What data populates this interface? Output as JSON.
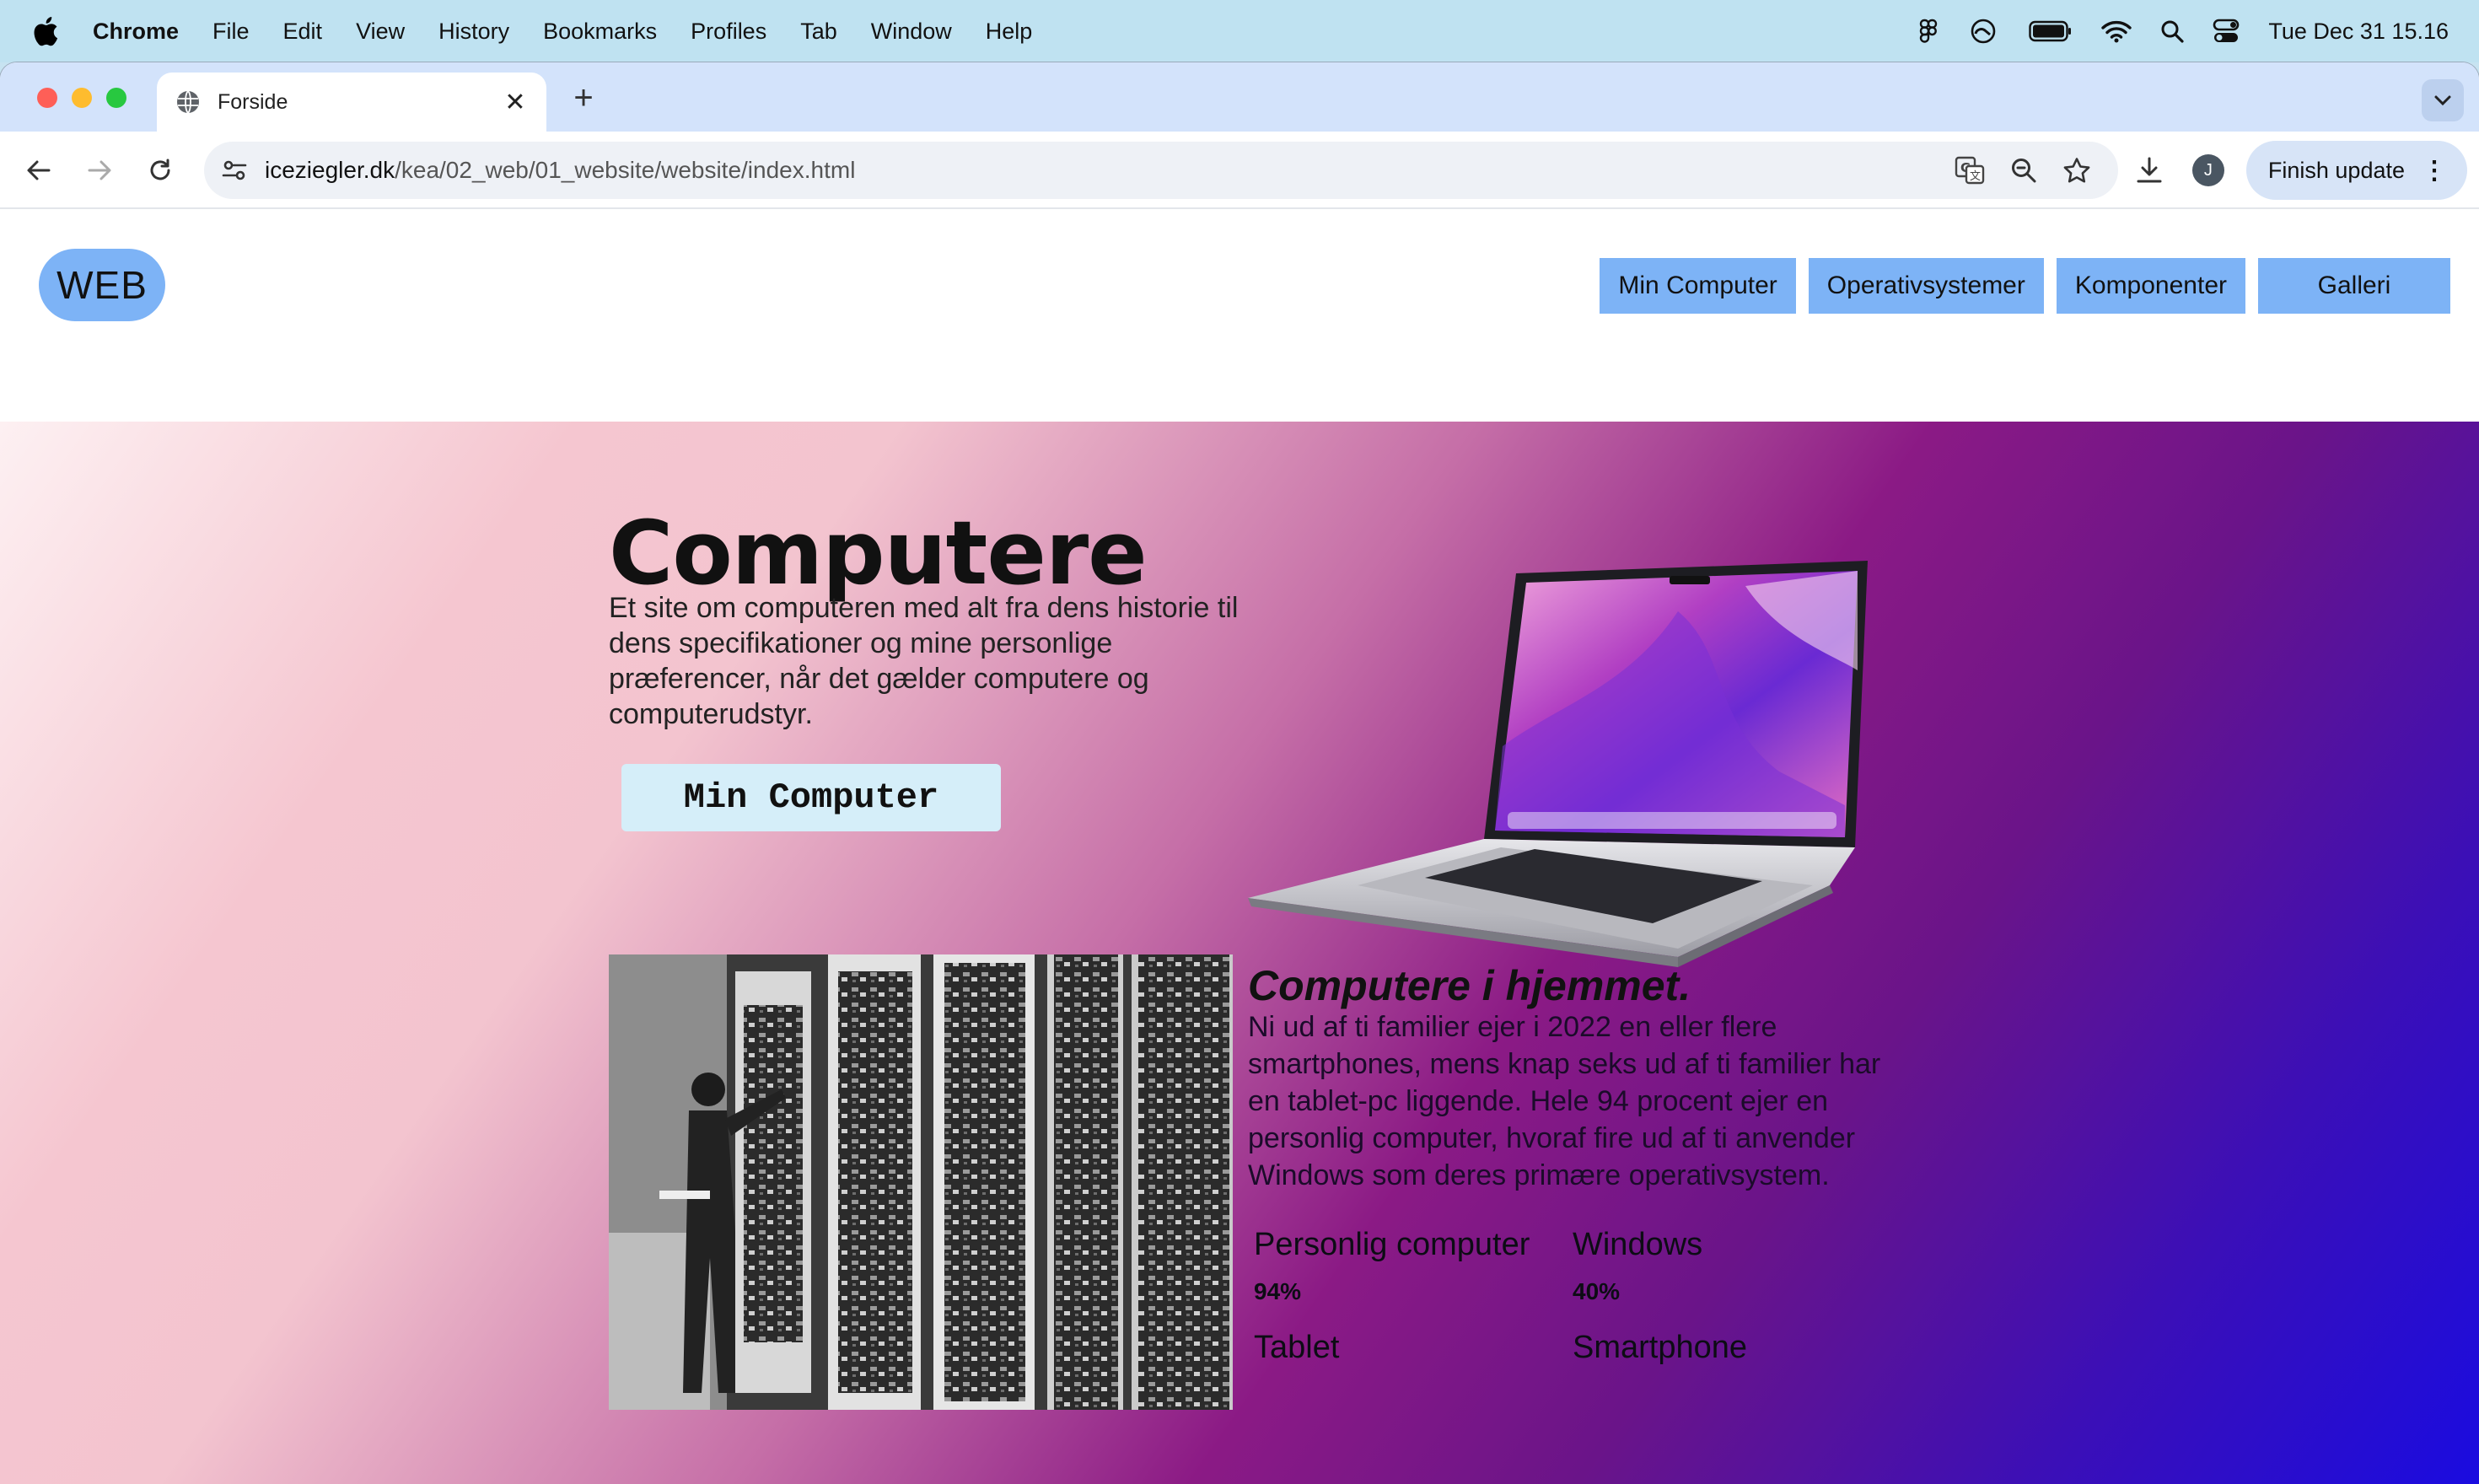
{
  "menubar": {
    "app_name": "Chrome",
    "items": [
      "File",
      "Edit",
      "View",
      "History",
      "Bookmarks",
      "Profiles",
      "Tab",
      "Window",
      "Help"
    ],
    "clock": "Tue Dec 31  15.16"
  },
  "browser": {
    "tab_title": "Forside",
    "url_host": "iceziegler.dk",
    "url_path": "/kea/02_web/01_website/website/index.html",
    "profile_initial": "J",
    "finish_update_label": "Finish update"
  },
  "site": {
    "logo": "WEB",
    "nav": [
      "Min Computer",
      "Operativsystemer",
      "Komponenter",
      "Galleri"
    ],
    "accent_color": "#7db3f6"
  },
  "hero": {
    "title": "Computere",
    "lead": "Et site om computeren med alt fra dens historie til dens specifikationer og mine personlige præferencer, når det gælder computere og computerudstyr.",
    "cta_label": "Min Computer"
  },
  "section": {
    "heading": "Computere i hjemmet.",
    "paragraph": "Ni ud af ti familier ejer i 2022 en eller flere smartphones, mens knap seks ud af ti familier har en tablet-pc liggende. Hele 94 procent ejer en personlig computer, hvoraf fire ud af ti anvender Windows som deres primære operativsystem.",
    "stats": [
      {
        "label": "Personlig computer",
        "value": "94%"
      },
      {
        "label": "Windows",
        "value": "40%"
      },
      {
        "label": "Tablet",
        "value": ""
      },
      {
        "label": "Smartphone",
        "value": ""
      }
    ]
  }
}
